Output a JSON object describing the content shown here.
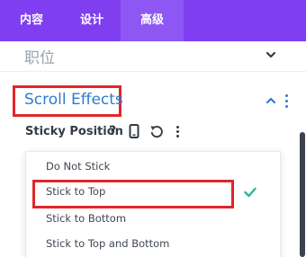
{
  "tabs": [
    {
      "label": "内容"
    },
    {
      "label": "设计"
    },
    {
      "label": "高级",
      "active": true
    }
  ],
  "section": {
    "title": "职位",
    "state": "collapsed",
    "icon": "chevron-down-icon"
  },
  "scroll_effects": {
    "title": "Scroll Effects",
    "state": "expanded",
    "icon": "chevron-up-icon"
  },
  "sticky_position": {
    "label": "Sticky Position",
    "help": "?",
    "icons": [
      "help-icon",
      "phone-icon",
      "undo-icon",
      "more-icon"
    ]
  },
  "dropdown": {
    "options": [
      {
        "label": "Do Not Stick"
      },
      {
        "label": "Stick to Top",
        "selected": true
      },
      {
        "label": "Stick to Bottom"
      },
      {
        "label": "Stick to Top and Bottom"
      }
    ]
  },
  "colors": {
    "tab_bar": "#7f3ef0",
    "accent_blue": "#2e7bd3",
    "highlight_red": "#e0262a",
    "check_teal": "#2eb3a0"
  }
}
